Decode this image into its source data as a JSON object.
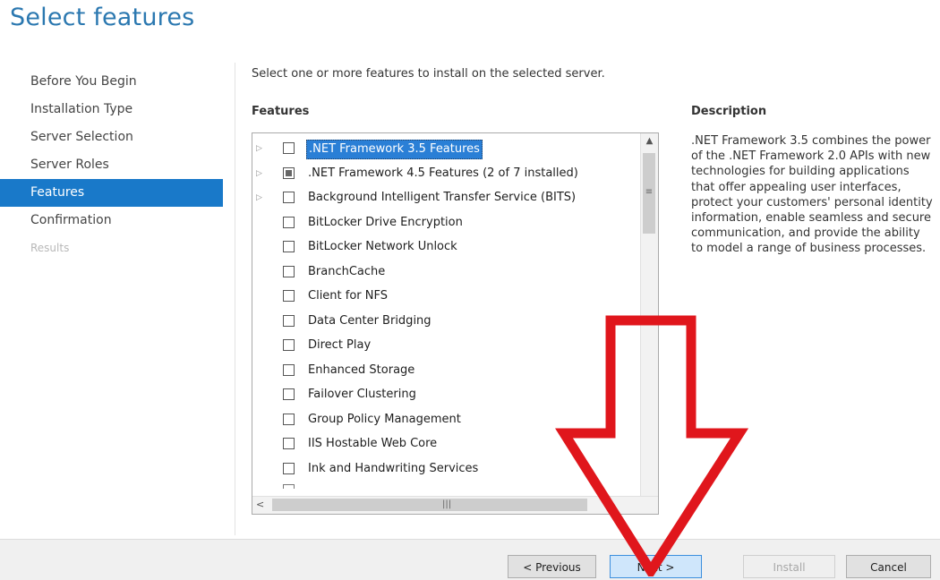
{
  "page": {
    "title": "Select features"
  },
  "nav": {
    "items": [
      {
        "label": "Before You Begin",
        "state": "normal"
      },
      {
        "label": "Installation Type",
        "state": "normal"
      },
      {
        "label": "Server Selection",
        "state": "normal"
      },
      {
        "label": "Server Roles",
        "state": "normal"
      },
      {
        "label": "Features",
        "state": "active"
      },
      {
        "label": "Confirmation",
        "state": "normal"
      },
      {
        "label": "Results",
        "state": "disabled"
      }
    ]
  },
  "main": {
    "intro": "Select one or more features to install on the selected server.",
    "features_label": "Features",
    "features": [
      {
        "label": ".NET Framework 3.5 Features",
        "expander": true,
        "checked": "unchecked",
        "selected": true
      },
      {
        "label": ".NET Framework 4.5 Features (2 of 7 installed)",
        "expander": true,
        "checked": "partial",
        "selected": false
      },
      {
        "label": "Background Intelligent Transfer Service (BITS)",
        "expander": true,
        "checked": "unchecked",
        "selected": false
      },
      {
        "label": "BitLocker Drive Encryption",
        "expander": false,
        "checked": "unchecked",
        "selected": false
      },
      {
        "label": "BitLocker Network Unlock",
        "expander": false,
        "checked": "unchecked",
        "selected": false
      },
      {
        "label": "BranchCache",
        "expander": false,
        "checked": "unchecked",
        "selected": false
      },
      {
        "label": "Client for NFS",
        "expander": false,
        "checked": "unchecked",
        "selected": false
      },
      {
        "label": "Data Center Bridging",
        "expander": false,
        "checked": "unchecked",
        "selected": false
      },
      {
        "label": "Direct Play",
        "expander": false,
        "checked": "unchecked",
        "selected": false
      },
      {
        "label": "Enhanced Storage",
        "expander": false,
        "checked": "unchecked",
        "selected": false
      },
      {
        "label": "Failover Clustering",
        "expander": false,
        "checked": "unchecked",
        "selected": false
      },
      {
        "label": "Group Policy Management",
        "expander": false,
        "checked": "unchecked",
        "selected": false
      },
      {
        "label": "IIS Hostable Web Core",
        "expander": false,
        "checked": "unchecked",
        "selected": false
      },
      {
        "label": "Ink and Handwriting Services",
        "expander": false,
        "checked": "unchecked",
        "selected": false
      }
    ],
    "description_label": "Description",
    "description": ".NET Framework 3.5 combines the power of the .NET Framework 2.0 APIs with new technologies for building applications that offer appealing user interfaces, protect your customers' personal identity information, enable seamless and secure communication, and provide the ability to model a range of business processes."
  },
  "footer": {
    "previous_label": "< Previous",
    "next_label": "Next >",
    "install_label": "Install",
    "cancel_label": "Cancel"
  },
  "icons": {
    "expander": "triangle-right-icon",
    "scroll_up": "chevron-up-icon",
    "scroll_left": "chevron-left-icon",
    "overlay": "red-down-arrow-icon"
  },
  "colors": {
    "accent": "#1979c9",
    "title": "#2b78b0",
    "selection": "#2a7fd6",
    "overlay_arrow": "#e0161c"
  }
}
